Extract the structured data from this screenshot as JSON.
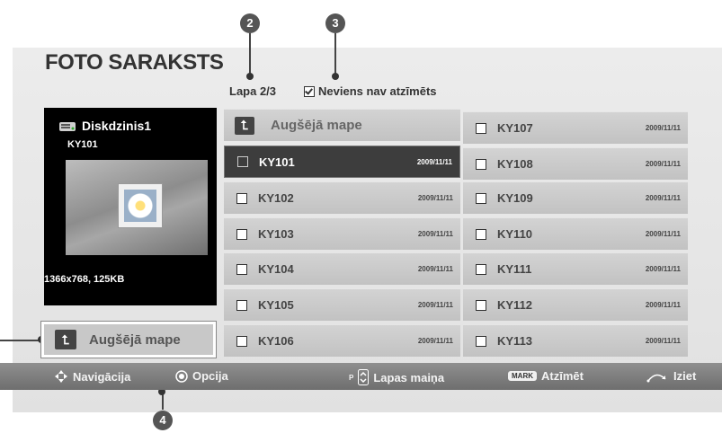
{
  "title": "FOTO SARAKSTS",
  "page_info": "Lapa 2/3",
  "mark_status": "Neviens nav atzīmēts",
  "callouts": {
    "c2": "2",
    "c3": "3",
    "c4": "4"
  },
  "preview": {
    "device": "Diskdzinis1",
    "filename": "KY101",
    "info": "1366x768, 125KB"
  },
  "up_folder_label": "Augšējā mape",
  "grid_up_label": "Augšējā mape",
  "col1": [
    {
      "name": "KY101",
      "date": "2009/11/11"
    },
    {
      "name": "KY102",
      "date": "2009/11/11"
    },
    {
      "name": "KY103",
      "date": "2009/11/11"
    },
    {
      "name": "KY104",
      "date": "2009/11/11"
    },
    {
      "name": "KY105",
      "date": "2009/11/11"
    },
    {
      "name": "KY106",
      "date": "2009/11/11"
    }
  ],
  "col2": [
    {
      "name": "KY107",
      "date": "2009/11/11"
    },
    {
      "name": "KY108",
      "date": "2009/11/11"
    },
    {
      "name": "KY109",
      "date": "2009/11/11"
    },
    {
      "name": "KY110",
      "date": "2009/11/11"
    },
    {
      "name": "KY111",
      "date": "2009/11/11"
    },
    {
      "name": "KY112",
      "date": "2009/11/11"
    },
    {
      "name": "KY113",
      "date": "2009/11/11"
    }
  ],
  "bottom": {
    "nav": "Navigācija",
    "option": "Opcija",
    "page_prefix": "P",
    "page_change": "Lapas maiņa",
    "mark_badge": "MARK",
    "mark": "Atzīmēt",
    "exit": "Iziet"
  },
  "colors": {
    "selected": "#3d3d3d",
    "cell": "#c8c8c8",
    "bar": "#7a7a7a"
  }
}
